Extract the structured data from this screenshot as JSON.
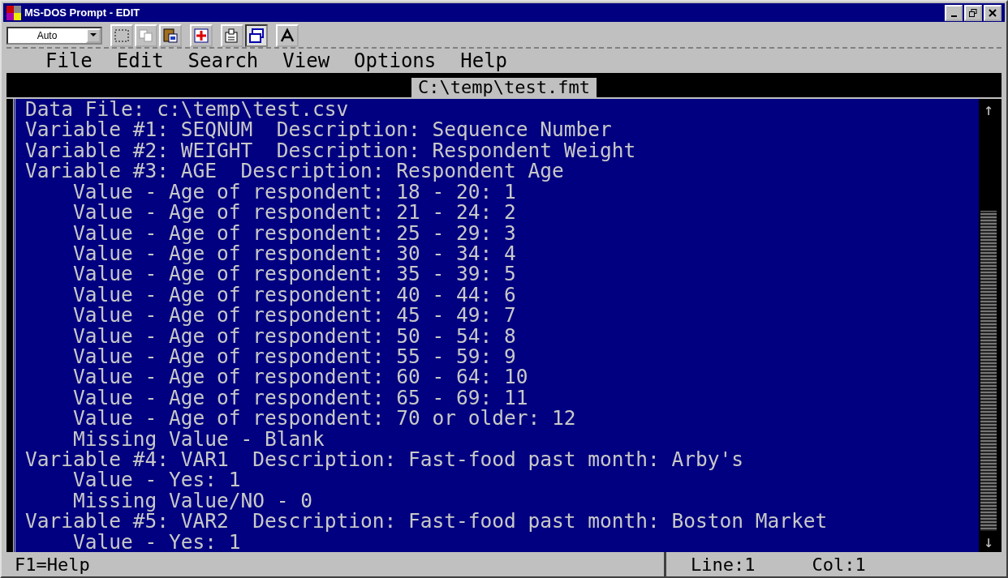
{
  "window": {
    "title": "MS-DOS Prompt - EDIT"
  },
  "toolbar": {
    "font_size": "Auto"
  },
  "menu": [
    "File",
    "Edit",
    "Search",
    "View",
    "Options",
    "Help"
  ],
  "editor": {
    "file_title": "C:\\temp\\test.fmt",
    "lines": [
      "Data File: c:\\temp\\test.csv",
      "Variable #1: SEQNUM  Description: Sequence Number",
      "Variable #2: WEIGHT  Description: Respondent Weight",
      "Variable #3: AGE  Description: Respondent Age",
      "    Value - Age of respondent: 18 - 20: 1",
      "    Value - Age of respondent: 21 - 24: 2",
      "    Value - Age of respondent: 25 - 29: 3",
      "    Value - Age of respondent: 30 - 34: 4",
      "    Value - Age of respondent: 35 - 39: 5",
      "    Value - Age of respondent: 40 - 44: 6",
      "    Value - Age of respondent: 45 - 49: 7",
      "    Value - Age of respondent: 50 - 54: 8",
      "    Value - Age of respondent: 55 - 59: 9",
      "    Value - Age of respondent: 60 - 64: 10",
      "    Value - Age of respondent: 65 - 69: 11",
      "    Value - Age of respondent: 70 or older: 12",
      "    Missing Value - Blank",
      "Variable #4: VAR1  Description: Fast-food past month: Arby's",
      "    Value - Yes: 1",
      "    Missing Value/NO - 0",
      "Variable #5: VAR2  Description: Fast-food past month: Boston Market",
      "    Value - Yes: 1"
    ],
    "scroll_up": "↑",
    "scroll_down": "↓"
  },
  "status_bar": {
    "help": "F1=Help",
    "line": "Line:1",
    "col": "Col:1"
  }
}
